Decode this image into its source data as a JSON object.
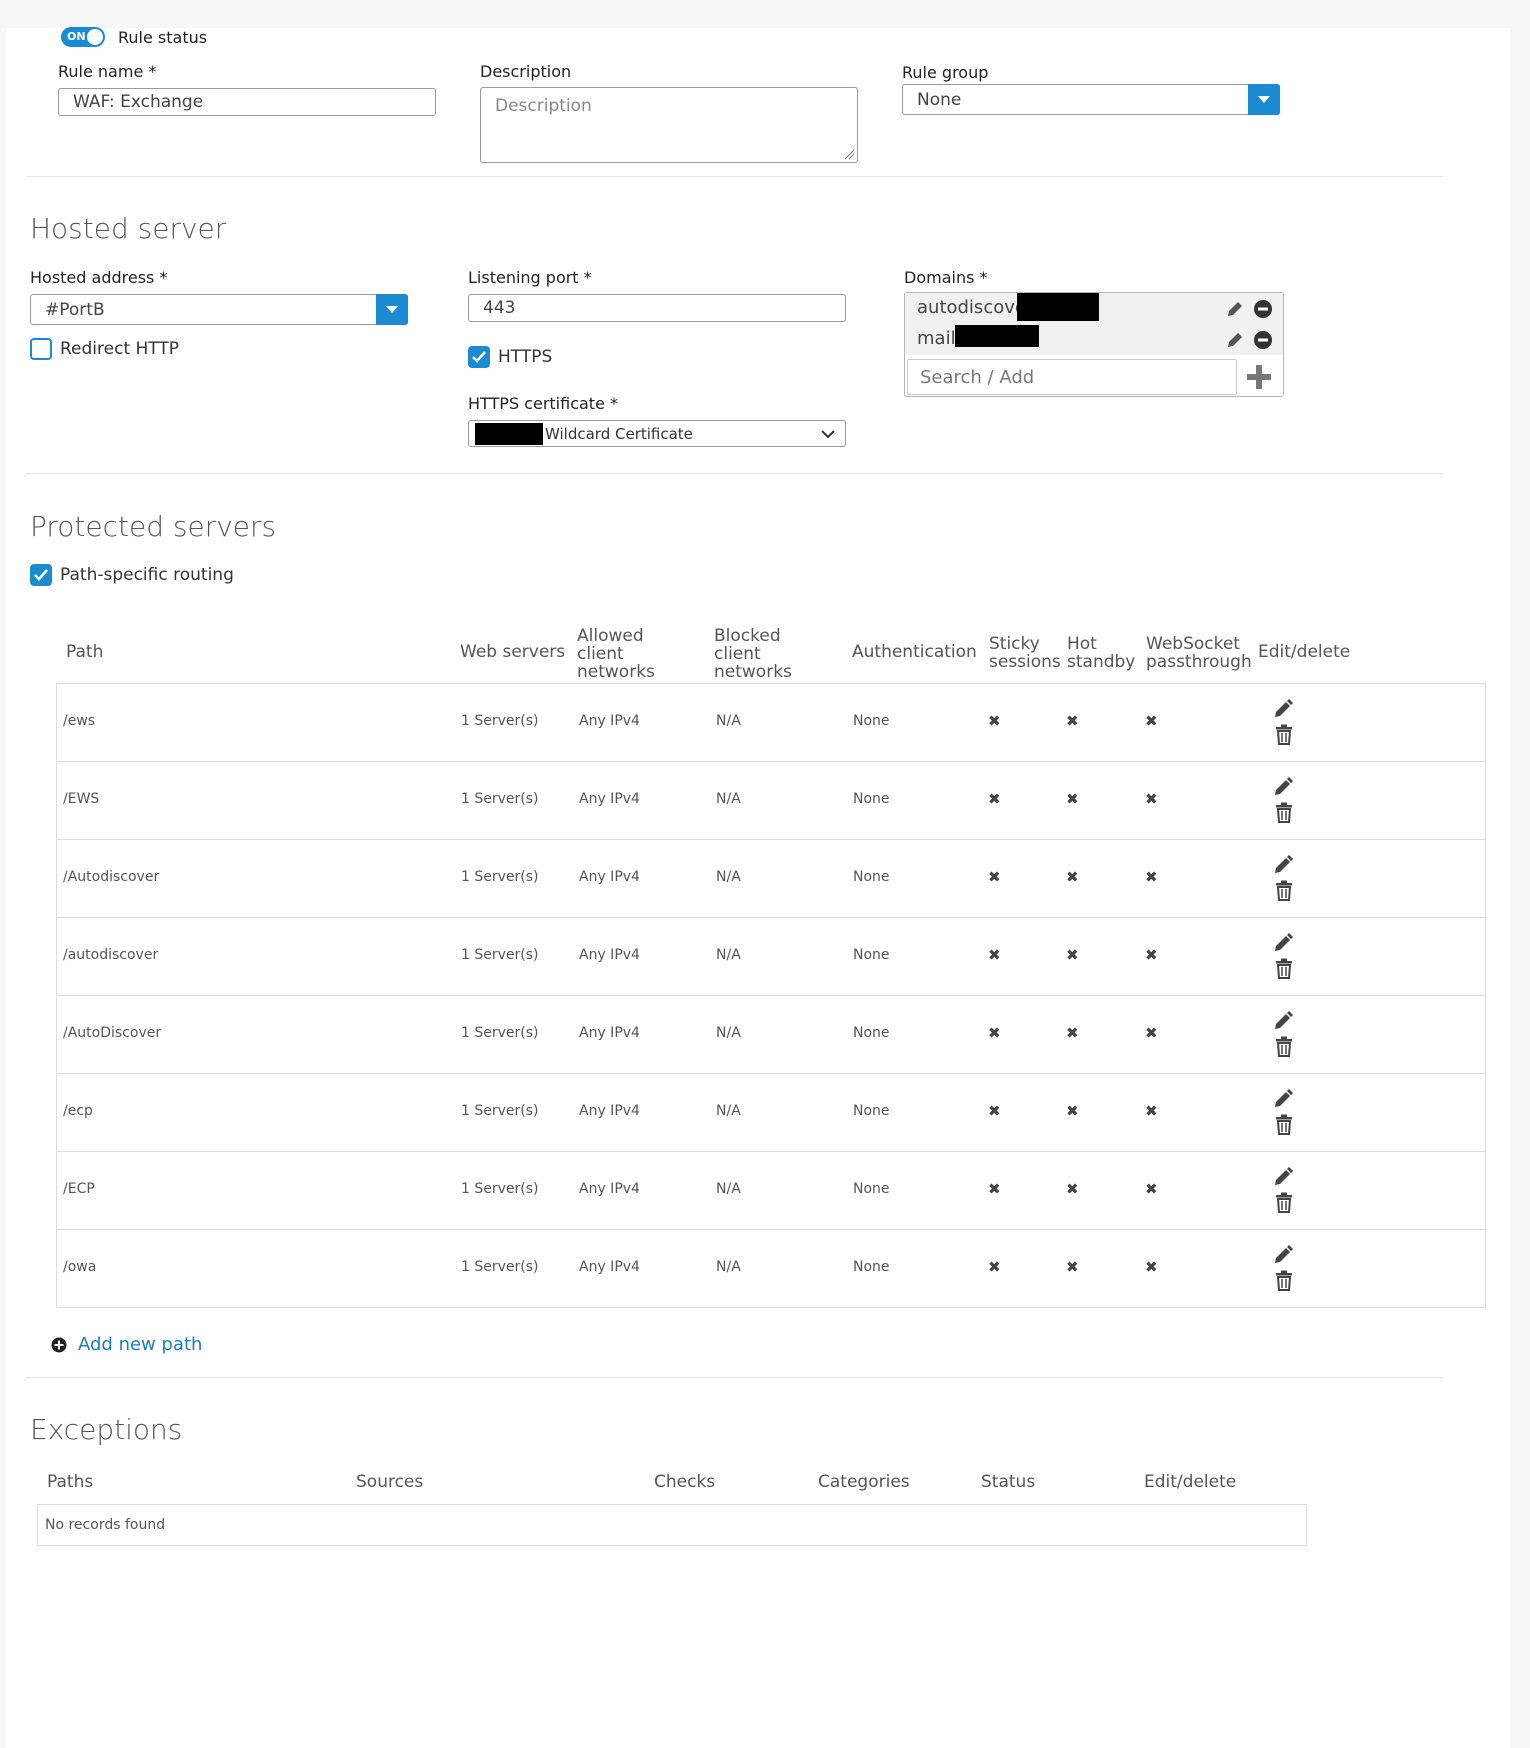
{
  "rule_status": {
    "toggle_text": "ON",
    "label": "Rule status"
  },
  "rule_name": {
    "label": "Rule name *",
    "value": "WAF: Exchange"
  },
  "description": {
    "label": "Description",
    "placeholder": "Description"
  },
  "rule_group": {
    "label": "Rule group",
    "value": "None"
  },
  "hosted_server": {
    "title": "Hosted server",
    "hosted_address": {
      "label": "Hosted address *",
      "value": "#PortB"
    },
    "redirect_http": {
      "label": "Redirect HTTP",
      "checked": false
    },
    "listening_port": {
      "label": "Listening port *",
      "value": "443"
    },
    "https": {
      "label": "HTTPS",
      "checked": true
    },
    "https_certificate": {
      "label": "HTTPS certificate *",
      "value": "Wildcard Certificate"
    },
    "domains": {
      "label": "Domains *",
      "items": [
        {
          "text": "autodiscover"
        },
        {
          "text": "mail."
        }
      ],
      "search_placeholder": "Search / Add"
    }
  },
  "protected_servers": {
    "title": "Protected servers",
    "path_specific_routing": {
      "label": "Path-specific routing",
      "checked": true
    },
    "columns": {
      "path": "Path",
      "web_servers": "Web servers",
      "allowed": [
        "Allowed",
        "client",
        "networks"
      ],
      "blocked": [
        "Blocked",
        "client",
        "networks"
      ],
      "authentication": "Authentication",
      "sticky": [
        "Sticky",
        "sessions"
      ],
      "hot": [
        "Hot",
        "standby"
      ],
      "websocket": [
        "WebSocket",
        "passthrough"
      ],
      "edit_delete": "Edit/delete"
    },
    "rows": [
      {
        "path": "/ews",
        "web_servers": "1 Server(s)",
        "allowed": "Any IPv4",
        "blocked": "N/A",
        "auth": "None"
      },
      {
        "path": "/EWS",
        "web_servers": "1 Server(s)",
        "allowed": "Any IPv4",
        "blocked": "N/A",
        "auth": "None"
      },
      {
        "path": "/Autodiscover",
        "web_servers": "1 Server(s)",
        "allowed": "Any IPv4",
        "blocked": "N/A",
        "auth": "None"
      },
      {
        "path": "/autodiscover",
        "web_servers": "1 Server(s)",
        "allowed": "Any IPv4",
        "blocked": "N/A",
        "auth": "None"
      },
      {
        "path": "/AutoDiscover",
        "web_servers": "1 Server(s)",
        "allowed": "Any IPv4",
        "blocked": "N/A",
        "auth": "None"
      },
      {
        "path": "/ecp",
        "web_servers": "1 Server(s)",
        "allowed": "Any IPv4",
        "blocked": "N/A",
        "auth": "None"
      },
      {
        "path": "/ECP",
        "web_servers": "1 Server(s)",
        "allowed": "Any IPv4",
        "blocked": "N/A",
        "auth": "None"
      },
      {
        "path": "/owa",
        "web_servers": "1 Server(s)",
        "allowed": "Any IPv4",
        "blocked": "N/A",
        "auth": "None"
      }
    ],
    "x_mark": "✖",
    "add_new_path": "Add new path"
  },
  "exceptions": {
    "title": "Exceptions",
    "columns": {
      "paths": "Paths",
      "sources": "Sources",
      "checks": "Checks",
      "categories": "Categories",
      "status": "Status",
      "edit_delete": "Edit/delete"
    },
    "empty_text": "No records found"
  },
  "colors": {
    "accent": "#1a8bd0",
    "link": "#1a7fc1"
  }
}
